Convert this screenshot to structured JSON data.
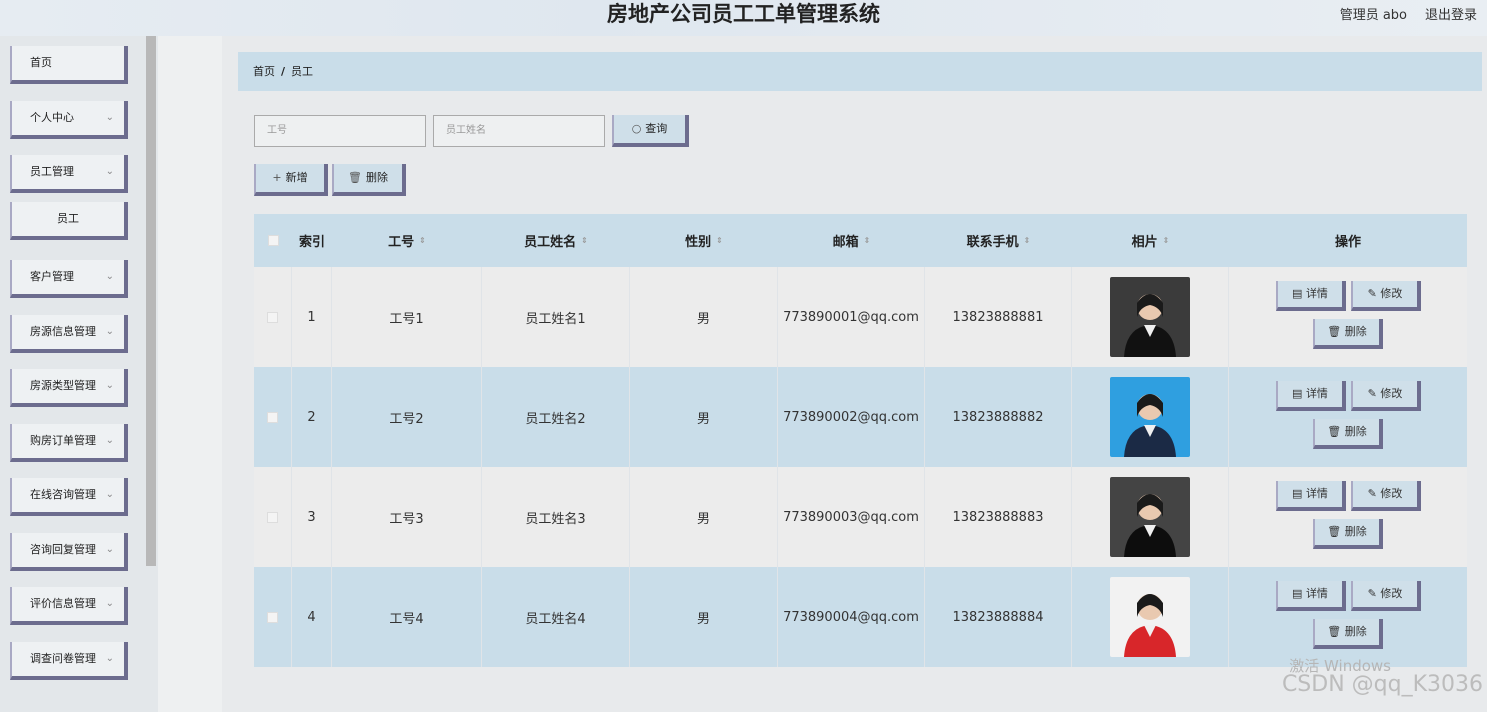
{
  "header": {
    "title": "房地产公司员工工单管理系统",
    "user": "管理员 abo",
    "logout": "退出登录"
  },
  "sidebar": {
    "items": [
      {
        "label": "首页",
        "chev": ""
      },
      {
        "label": "个人中心",
        "chev": "⌄"
      },
      {
        "label": "员工管理",
        "chev": "⌄"
      },
      {
        "label": "员工",
        "chev": ""
      },
      {
        "label": "客户管理",
        "chev": "⌄"
      },
      {
        "label": "房源信息管理",
        "chev": "⌄"
      },
      {
        "label": "房源类型管理",
        "chev": "⌄"
      },
      {
        "label": "购房订单管理",
        "chev": "⌄"
      },
      {
        "label": "在线咨询管理",
        "chev": "⌄"
      },
      {
        "label": "咨询回复管理",
        "chev": "⌄"
      },
      {
        "label": "评价信息管理",
        "chev": "⌄"
      },
      {
        "label": "调查问卷管理",
        "chev": "⌄"
      }
    ]
  },
  "breadcrumb": {
    "home": "首页",
    "sep": "/",
    "current": "员工"
  },
  "search": {
    "id_placeholder": "工号",
    "name_placeholder": "员工姓名",
    "query_label": "查询"
  },
  "toolbar": {
    "add_label": "新增",
    "delete_label": "删除"
  },
  "table": {
    "headers": {
      "index": "索引",
      "id": "工号",
      "name": "员工姓名",
      "gender": "性别",
      "email": "邮箱",
      "phone": "联系手机",
      "photo": "相片",
      "ops": "操作"
    },
    "rows": [
      {
        "index": "1",
        "id": "工号1",
        "name": "员工姓名1",
        "gender": "男",
        "email": "773890001@qq.com",
        "phone": "13823888881"
      },
      {
        "index": "2",
        "id": "工号2",
        "name": "员工姓名2",
        "gender": "男",
        "email": "773890002@qq.com",
        "phone": "13823888882"
      },
      {
        "index": "3",
        "id": "工号3",
        "name": "员工姓名3",
        "gender": "男",
        "email": "773890003@qq.com",
        "phone": "13823888883"
      },
      {
        "index": "4",
        "id": "工号4",
        "name": "员工姓名4",
        "gender": "男",
        "email": "773890004@qq.com",
        "phone": "13823888884"
      }
    ],
    "actions": {
      "detail": "详情",
      "edit": "修改",
      "delete": "删除"
    }
  },
  "watermark": {
    "line1": "激活 Windows",
    "line2": "CSDN @qq_K3036"
  }
}
